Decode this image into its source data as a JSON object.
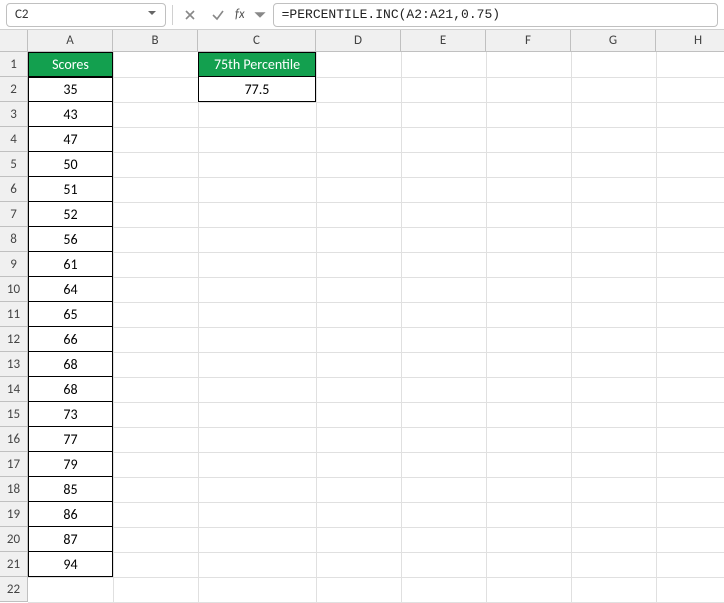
{
  "namebox": {
    "value": "C2"
  },
  "formula_bar": {
    "fx_label": "fx",
    "value": "=PERCENTILE.INC(A2:A21,0.75)"
  },
  "columns": [
    "A",
    "B",
    "C",
    "D",
    "E",
    "F",
    "G",
    "H"
  ],
  "rows": [
    "1",
    "2",
    "3",
    "4",
    "5",
    "6",
    "7",
    "8",
    "9",
    "10",
    "11",
    "12",
    "13",
    "14",
    "15",
    "16",
    "17",
    "18",
    "19",
    "20",
    "21",
    "22"
  ],
  "colA": {
    "header": "Scores",
    "values": [
      "35",
      "43",
      "47",
      "50",
      "51",
      "52",
      "56",
      "61",
      "64",
      "65",
      "66",
      "68",
      "68",
      "73",
      "77",
      "79",
      "85",
      "86",
      "87",
      "94"
    ]
  },
  "colC": {
    "header": "75th Percentile",
    "value": "77.5"
  },
  "chart_data": {
    "type": "table",
    "title": "Scores and 75th Percentile",
    "columns": [
      "Scores"
    ],
    "data": [
      35,
      43,
      47,
      50,
      51,
      52,
      56,
      61,
      64,
      65,
      66,
      68,
      68,
      73,
      77,
      79,
      85,
      86,
      87,
      94
    ],
    "computed": {
      "label": "75th Percentile",
      "formula": "PERCENTILE.INC(A2:A21,0.75)",
      "value": 77.5
    }
  }
}
